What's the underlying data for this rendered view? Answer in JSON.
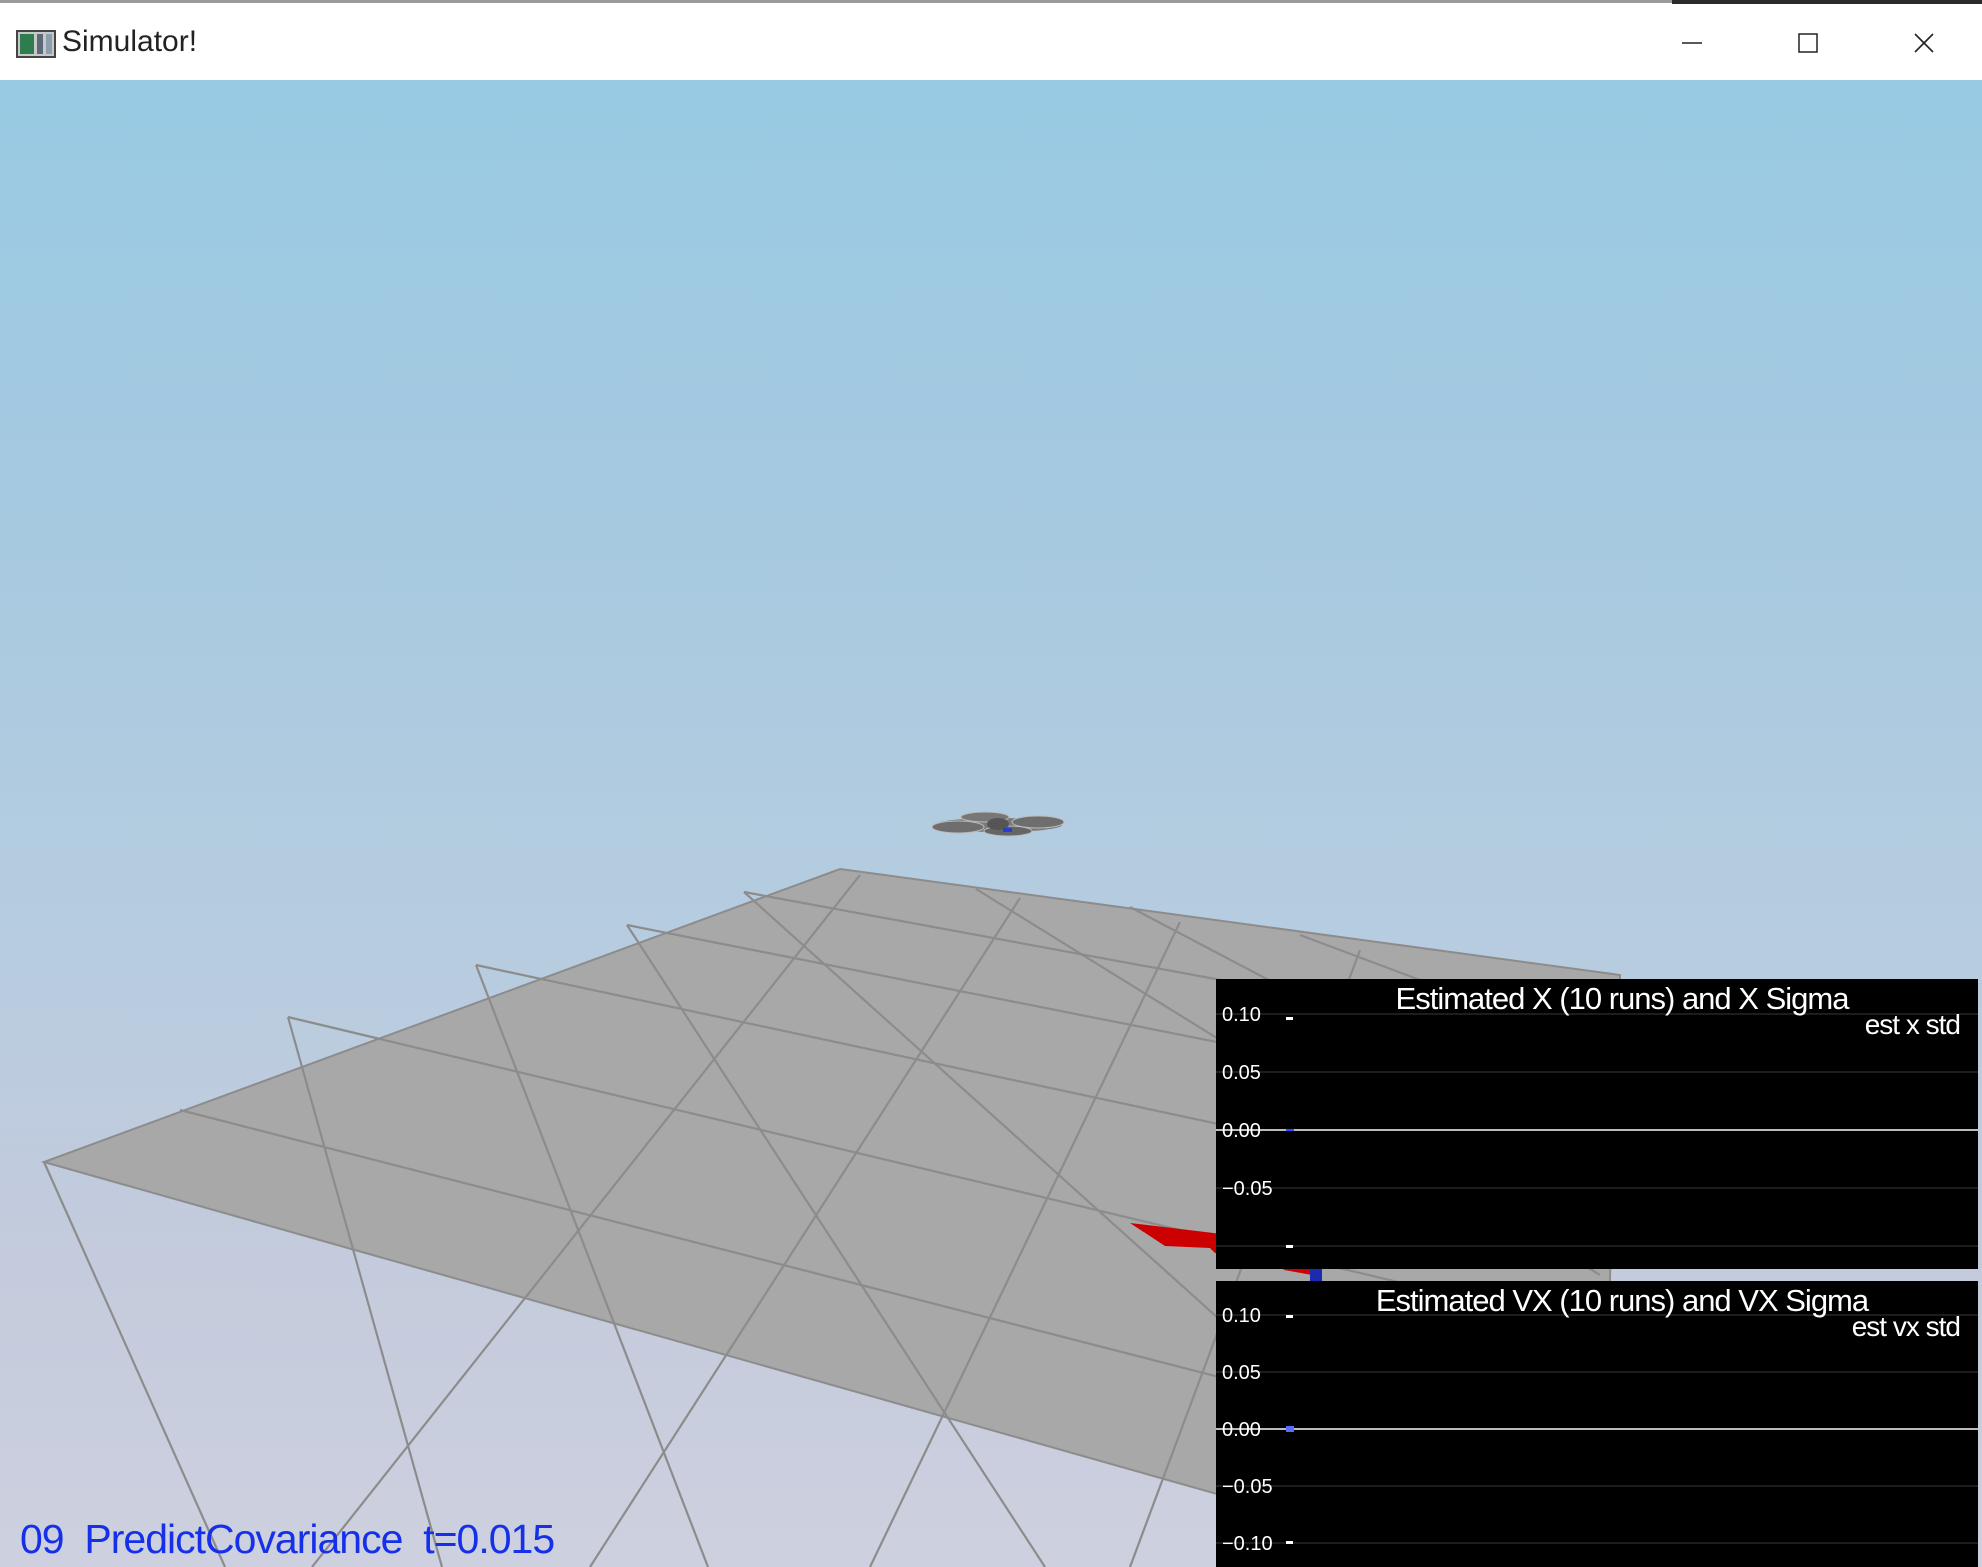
{
  "window": {
    "title": "Simulator!",
    "icons": {
      "app": "simulator-app-icon",
      "minimize": "minimize-icon",
      "maximize": "maximize-icon",
      "close": "close-icon"
    }
  },
  "scene": {
    "sky_top": "#98cae3",
    "sky_bottom": "#cdd0df",
    "ground_color": "#a8a8a8",
    "grid_line_color": "#8c8c8c",
    "arrow_color": "#cc0000",
    "drone_color": "#6e6e6e"
  },
  "plots": [
    {
      "title": "Estimated X (10 runs) and X Sigma",
      "legend": "est x std",
      "chart_data": {
        "type": "line",
        "title": "Estimated X (10 runs) and X Sigma",
        "series": [
          {
            "name": "est x std",
            "values": []
          }
        ],
        "yticks": [
          "0.10",
          "0.05",
          "0.00",
          "−0.05"
        ],
        "ylim": [
          -0.1,
          0.1
        ],
        "grid": true
      }
    },
    {
      "title": "Estimated VX (10 runs) and VX Sigma",
      "legend": "est vx std",
      "chart_data": {
        "type": "line",
        "title": "Estimated VX (10 runs) and VX Sigma",
        "series": [
          {
            "name": "est vx std",
            "values": []
          }
        ],
        "yticks": [
          "0.10",
          "0.05",
          "0.00",
          "−0.05",
          "−0.10"
        ],
        "ylim": [
          -0.1,
          0.1
        ],
        "grid": true
      }
    }
  ],
  "status": {
    "scenario": "09",
    "name": "PredictCovariance",
    "time": "t=0.015"
  }
}
